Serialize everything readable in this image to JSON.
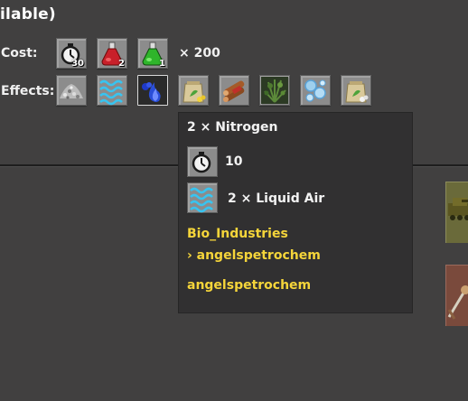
{
  "header": {
    "title": "ilable)"
  },
  "cost": {
    "label": "Cost:",
    "items": [
      {
        "icon": "stopwatch-icon",
        "count": "30"
      },
      {
        "icon": "red-science-flask-icon",
        "count": "2"
      },
      {
        "icon": "green-science-flask-icon",
        "count": "1"
      }
    ],
    "multiplier": "× 200"
  },
  "effects": {
    "label": "Effects:",
    "items": [
      {
        "icon": "gravel-pile-icon"
      },
      {
        "icon": "liquid-air-waves-icon"
      },
      {
        "icon": "nitrogen-gas-icon",
        "selected": true
      },
      {
        "icon": "seed-bag-yellow-icon"
      },
      {
        "icon": "wood-logs-icon"
      },
      {
        "icon": "plant-bush-icon"
      },
      {
        "icon": "water-bubbles-icon"
      },
      {
        "icon": "seed-bag-white-icon"
      }
    ]
  },
  "tooltip": {
    "title": "2 × Nitrogen",
    "time_value": "10",
    "ingredient_label": "2 × Liquid Air",
    "mod_line_1": "Bio_Industries",
    "mod_line_2": "› angelspetrochem",
    "mod_line_3": "angelspetrochem"
  },
  "colors": {
    "background": "#414040",
    "tooltip_bg": "#313031",
    "mod_text": "#f5d53a",
    "slot_bg": "#8c8c8c"
  }
}
